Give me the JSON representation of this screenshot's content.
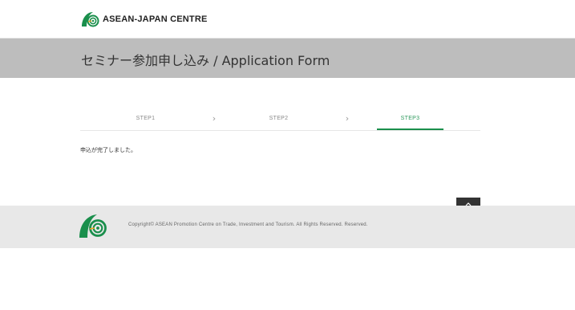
{
  "header": {
    "logo_text": "ASEAN-JAPAN CENTRE",
    "logo_icon": "asean-japan-centre-logo",
    "brand_colors": [
      "#1a8f4c",
      "#f0a51e"
    ]
  },
  "title_bar": {
    "title": "セミナー参加申し込み / Application Form"
  },
  "steps": {
    "items": [
      {
        "label": "STEP1",
        "active": false
      },
      {
        "label": "STEP2",
        "active": false
      },
      {
        "label": "STEP3",
        "active": true
      }
    ],
    "separator_icon": "chevron-right-icon",
    "active_color": "#1a8f4c"
  },
  "main": {
    "message": "申込が完了しました。"
  },
  "back_to_top": {
    "icon": "chevron-up-icon"
  },
  "footer": {
    "logo_icon": "asean-japan-centre-logo",
    "copyright": "Copyright© ASEAN Promotion Centre on Trade, Investment and Tourism. All Rights Reserved. Reserved."
  }
}
